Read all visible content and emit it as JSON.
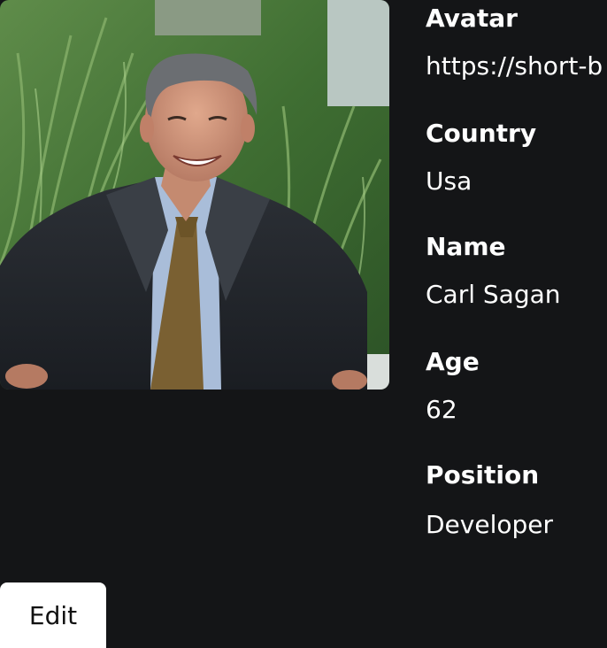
{
  "profile": {
    "fields": [
      {
        "label": "Avatar",
        "value": "https://short-b"
      },
      {
        "label": "Country",
        "value": "Usa"
      },
      {
        "label": "Name",
        "value": "Carl Sagan"
      },
      {
        "label": "Age",
        "value": "62"
      },
      {
        "label": "Position",
        "value": "Developer"
      }
    ]
  },
  "actions": {
    "edit_label": "Edit"
  },
  "colors": {
    "background": "#141517",
    "text": "#ffffff",
    "button_bg": "#ffffff",
    "button_text": "#111111"
  }
}
